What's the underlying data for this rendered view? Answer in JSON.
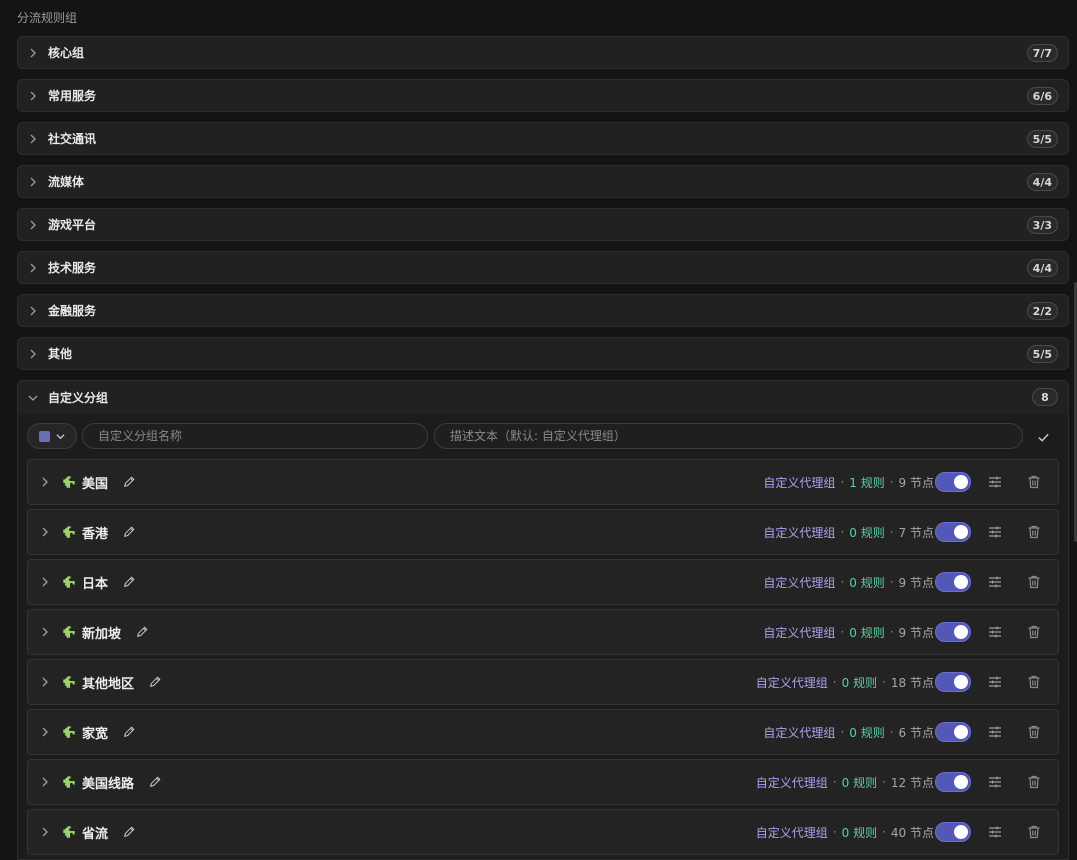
{
  "section_title": "分流规则组",
  "groups": [
    {
      "name": "核心组",
      "count": "7/7"
    },
    {
      "name": "常用服务",
      "count": "6/6"
    },
    {
      "name": "社交通讯",
      "count": "5/5"
    },
    {
      "name": "流媒体",
      "count": "4/4"
    },
    {
      "name": "游戏平台",
      "count": "3/3"
    },
    {
      "name": "技术服务",
      "count": "4/4"
    },
    {
      "name": "金融服务",
      "count": "2/2"
    },
    {
      "name": "其他",
      "count": "5/5"
    }
  ],
  "custom_group": {
    "name": "自定义分组",
    "count": "8",
    "form": {
      "name_value": "",
      "name_placeholder": "自定义分组名称",
      "desc_value": "",
      "desc_placeholder": "描述文本（默认: 自定义代理组）"
    },
    "rules": [
      {
        "name": "美国",
        "type": "自定义代理组",
        "rules": "1 规则",
        "nodes": "9 节点",
        "enabled": true
      },
      {
        "name": "香港",
        "type": "自定义代理组",
        "rules": "0 规则",
        "nodes": "7 节点",
        "enabled": true
      },
      {
        "name": "日本",
        "type": "自定义代理组",
        "rules": "0 规则",
        "nodes": "9 节点",
        "enabled": true
      },
      {
        "name": "新加坡",
        "type": "自定义代理组",
        "rules": "0 规则",
        "nodes": "9 节点",
        "enabled": true
      },
      {
        "name": "其他地区",
        "type": "自定义代理组",
        "rules": "0 规则",
        "nodes": "18 节点",
        "enabled": true
      },
      {
        "name": "家宽",
        "type": "自定义代理组",
        "rules": "0 规则",
        "nodes": "6 节点",
        "enabled": true
      },
      {
        "name": "美国线路",
        "type": "自定义代理组",
        "rules": "0 规则",
        "nodes": "12 节点",
        "enabled": true
      },
      {
        "name": "省流",
        "type": "自定义代理组",
        "rules": "0 规则",
        "nodes": "40 节点",
        "enabled": true
      }
    ]
  },
  "colors": {
    "accent": "#5358b8",
    "rule_type": "#a8a3ee",
    "rule_count": "#5ccfa0",
    "puzzle_icon": "#9bd36a"
  }
}
